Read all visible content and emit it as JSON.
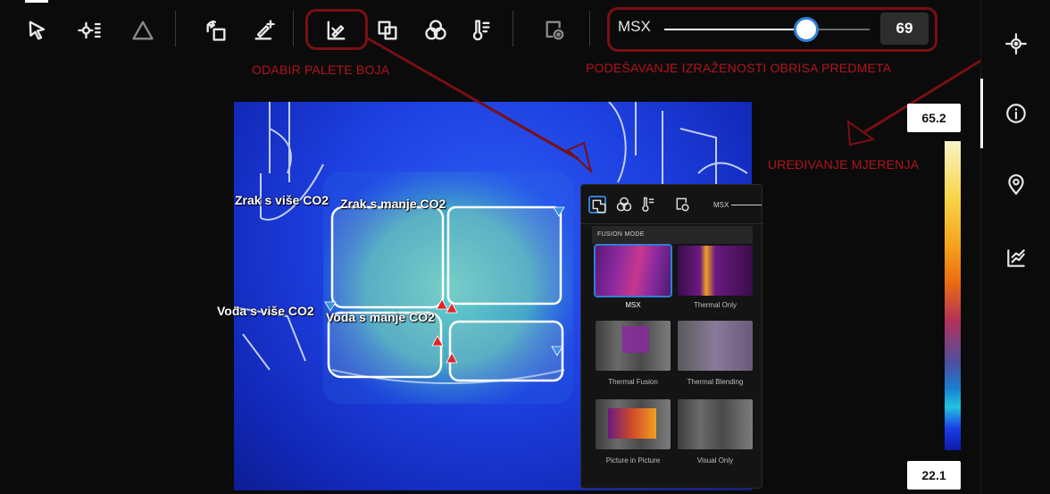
{
  "toolbar": {
    "tools": [
      "cursor-icon",
      "spot-add-icon",
      "triangle-icon",
      "rotate-icon",
      "annotate-icon",
      "palette-icon",
      "fusion-icon",
      "color-blend-icon",
      "thermometer-icon",
      "image-view-icon"
    ],
    "msx_label": "MSX",
    "msx_value": "69",
    "msx_level": 0.69
  },
  "annotations": {
    "palette": "ODABIR PALETE BOJA",
    "msx": "PODEŠAVANJE IZRAŽENOSTI OBRISA PREDMETA",
    "edit": "UREĐIVANJE MJERENJA"
  },
  "sidebar": {
    "items": [
      "measure-icon",
      "info-icon",
      "location-icon",
      "chart-icon"
    ]
  },
  "measurements": {
    "box1": "Zrak s više CO2",
    "box2": "Zrak s manje CO2",
    "box3": "Voda s više CO2",
    "box4": "Voda s manje CO2"
  },
  "fusion": {
    "title": "FUSION MODE",
    "msx_label": "MSX",
    "modes": [
      "MSX",
      "Thermal Only",
      "Thermal Fusion",
      "Thermal Blending",
      "Picture in Picture",
      "Visual Only"
    ]
  },
  "scale": {
    "max": "65.2",
    "min": "22.1"
  },
  "colors": {
    "accent": "#2f7fd6",
    "annotation": "#7a0f14",
    "hot_marker": "#e0242a",
    "cold_marker": "#3a8ee0"
  }
}
